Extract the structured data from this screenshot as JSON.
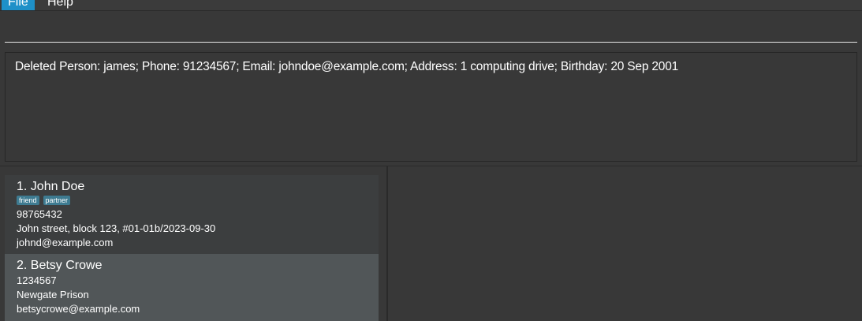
{
  "menu": {
    "file": "File",
    "help": "Help"
  },
  "command": {
    "value": ""
  },
  "result": {
    "text": "Deleted Person: james; Phone: 91234567; Email: johndoe@example.com; Address: 1 computing drive; Birthday: 20 Sep 2001"
  },
  "persons": [
    {
      "index_name": "1.  John Doe",
      "tags": [
        "friend",
        "partner"
      ],
      "phone": "98765432",
      "address": "John street, block 123, #01-01b/2023-09-30",
      "email": "johnd@example.com"
    },
    {
      "index_name": "2.  Betsy Crowe",
      "tags": [],
      "phone": "1234567",
      "address": "Newgate Prison",
      "email": "betsycrowe@example.com"
    }
  ],
  "colors": {
    "background": "#383838",
    "menu_selected": "#1e90c8",
    "tag_bg": "#3e7b91",
    "card_selected": "#515658"
  }
}
